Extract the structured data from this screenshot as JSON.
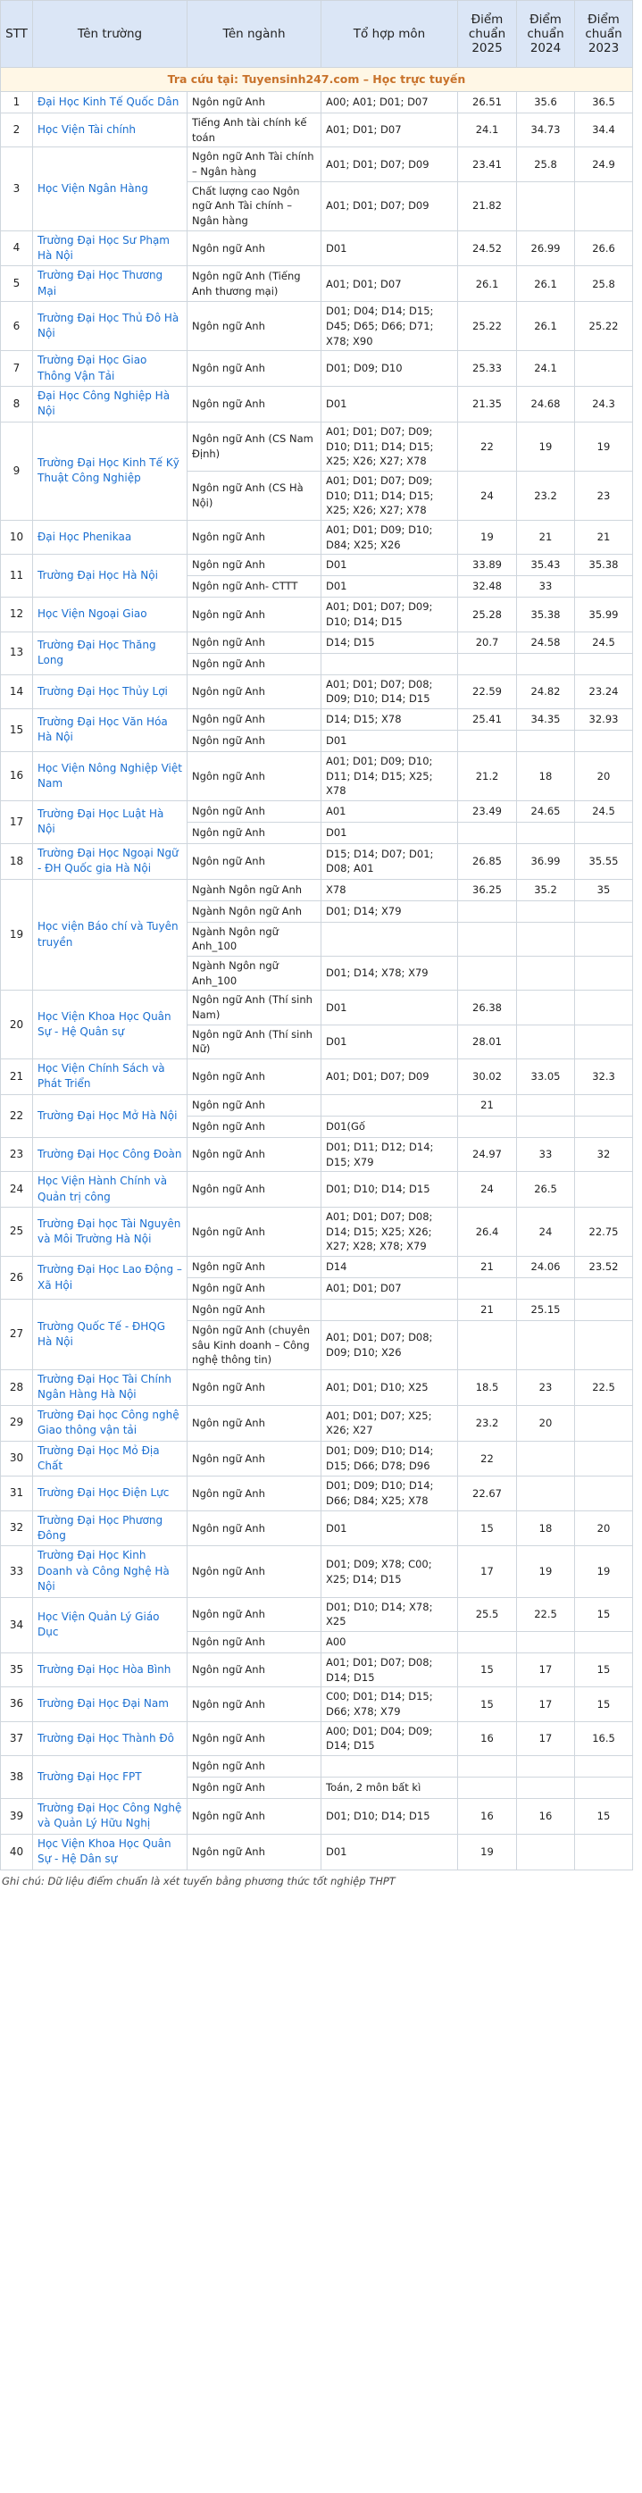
{
  "headers": {
    "stt": "STT",
    "school": "Tên trường",
    "major": "Tên ngành",
    "combo": "Tổ hợp môn",
    "y2025": "Điểm chuẩn 2025",
    "y2024": "Điểm chuẩn 2024",
    "y2023": "Điểm chuẩn 2023"
  },
  "banner": "Tra cứu tại: Tuyensinh247.com – Học trực tuyến",
  "rows": [
    {
      "stt": "1",
      "school": "Đại Học Kinh Tế Quốc Dân",
      "lines": [
        [
          "Ngôn ngữ Anh",
          "A00; A01; D01; D07",
          "26.51",
          "35.6",
          "36.5"
        ]
      ]
    },
    {
      "stt": "2",
      "school": "Học Viện Tài chính",
      "lines": [
        [
          "Tiếng Anh tài chính kế toán",
          "A01; D01; D07",
          "24.1",
          "34.73",
          "34.4"
        ]
      ]
    },
    {
      "stt": "3",
      "school": "Học Viện Ngân Hàng",
      "lines": [
        [
          "Ngôn ngữ Anh Tài chính – Ngân hàng",
          "A01; D01; D07; D09",
          "23.41",
          "25.8",
          "24.9"
        ],
        [
          "Chất lượng cao Ngôn ngữ Anh Tài chính – Ngân hàng",
          "A01; D01; D07; D09",
          "21.82",
          "",
          ""
        ]
      ]
    },
    {
      "stt": "4",
      "school": "Trường Đại Học Sư Phạm Hà Nội",
      "lines": [
        [
          "Ngôn ngữ Anh",
          "D01",
          "24.52",
          "26.99",
          "26.6"
        ]
      ]
    },
    {
      "stt": "5",
      "school": "Trường Đại Học Thương Mại",
      "lines": [
        [
          "Ngôn ngữ Anh (Tiếng Anh thương mại)",
          "A01; D01; D07",
          "26.1",
          "26.1",
          "25.8"
        ]
      ]
    },
    {
      "stt": "6",
      "school": "Trường Đại Học Thủ Đô Hà Nội",
      "lines": [
        [
          "Ngôn ngữ Anh",
          "D01; D04; D14; D15; D45; D65; D66; D71; X78; X90",
          "25.22",
          "26.1",
          "25.22"
        ]
      ]
    },
    {
      "stt": "7",
      "school": "Trường Đại Học Giao Thông Vận Tải",
      "lines": [
        [
          "Ngôn ngữ Anh",
          "D01; D09; D10",
          "25.33",
          "24.1",
          ""
        ]
      ]
    },
    {
      "stt": "8",
      "school": "Đại Học Công Nghiệp Hà Nội",
      "lines": [
        [
          "Ngôn ngữ Anh",
          "D01",
          "21.35",
          "24.68",
          "24.3"
        ]
      ]
    },
    {
      "stt": "9",
      "school": "Trường Đại Học Kinh Tế Kỹ Thuật Công Nghiệp",
      "lines": [
        [
          "Ngôn ngữ Anh (CS Nam Định)",
          "A01; D01; D07; D09; D10; D11; D14; D15; X25; X26; X27; X78",
          "22",
          "19",
          "19"
        ],
        [
          "Ngôn ngữ Anh (CS Hà Nội)",
          "A01; D01; D07; D09; D10; D11; D14; D15; X25; X26; X27; X78",
          "24",
          "23.2",
          "23"
        ]
      ]
    },
    {
      "stt": "10",
      "school": "Đại Học Phenikaa",
      "lines": [
        [
          "Ngôn ngữ Anh",
          "A01; D01; D09; D10; D84; X25; X26",
          "19",
          "21",
          "21"
        ]
      ]
    },
    {
      "stt": "11",
      "school": "Trường Đại Học Hà Nội",
      "lines": [
        [
          "Ngôn ngữ Anh",
          "D01",
          "33.89",
          "35.43",
          "35.38"
        ],
        [
          "Ngôn ngữ Anh- CTTT",
          "D01",
          "32.48",
          "33",
          ""
        ]
      ]
    },
    {
      "stt": "12",
      "school": "Học Viện Ngoại Giao",
      "lines": [
        [
          "Ngôn ngữ Anh",
          "A01; D01; D07; D09; D10; D14; D15",
          "25.28",
          "35.38",
          "35.99"
        ]
      ]
    },
    {
      "stt": "13",
      "school": "Trường Đại Học Thăng Long",
      "lines": [
        [
          "Ngôn ngữ Anh",
          "D14; D15",
          "20.7",
          "24.58",
          "24.5"
        ],
        [
          "Ngôn ngữ Anh",
          "",
          "",
          "",
          ""
        ]
      ]
    },
    {
      "stt": "14",
      "school": "Trường Đại Học Thủy Lợi",
      "lines": [
        [
          "Ngôn ngữ Anh",
          "A01; D01; D07; D08; D09; D10; D14; D15",
          "22.59",
          "24.82",
          "23.24"
        ]
      ]
    },
    {
      "stt": "15",
      "school": "Trường Đại Học Văn Hóa Hà Nội",
      "lines": [
        [
          "Ngôn ngữ Anh",
          "D14; D15; X78",
          "25.41",
          "34.35",
          "32.93"
        ],
        [
          "Ngôn ngữ Anh",
          "D01",
          "",
          "",
          ""
        ]
      ]
    },
    {
      "stt": "16",
      "school": "Học Viện Nông Nghiệp Việt Nam",
      "lines": [
        [
          "Ngôn ngữ Anh",
          "A01; D01; D09; D10; D11; D14; D15; X25; X78",
          "21.2",
          "18",
          "20"
        ]
      ]
    },
    {
      "stt": "17",
      "school": "Trường Đại Học Luật Hà Nội",
      "lines": [
        [
          "Ngôn ngữ Anh",
          "A01",
          "23.49",
          "24.65",
          "24.5"
        ],
        [
          "Ngôn ngữ Anh",
          "D01",
          "",
          "",
          ""
        ]
      ]
    },
    {
      "stt": "18",
      "school": "Trường Đại Học Ngoại Ngữ - ĐH Quốc gia Hà Nội",
      "lines": [
        [
          "Ngôn ngữ Anh",
          "D15; D14; D07; D01; D08; A01",
          "26.85",
          "36.99",
          "35.55"
        ]
      ]
    },
    {
      "stt": "19",
      "school": "Học viện Báo chí và Tuyên truyền",
      "lines": [
        [
          "Ngành Ngôn ngữ Anh",
          "X78",
          "36.25",
          "35.2",
          "35"
        ],
        [
          "Ngành Ngôn ngữ Anh",
          "D01; D14; X79",
          "",
          "",
          ""
        ],
        [
          "Ngành Ngôn ngữ Anh_100",
          "",
          "",
          "",
          ""
        ],
        [
          "Ngành Ngôn ngữ Anh_100",
          "D01; D14; X78; X79",
          "",
          "",
          ""
        ]
      ]
    },
    {
      "stt": "20",
      "school": "Học Viện Khoa Học Quân Sự - Hệ Quân sự",
      "lines": [
        [
          "Ngôn ngữ Anh (Thí sinh Nam)",
          "D01",
          "26.38",
          "",
          ""
        ],
        [
          "Ngôn ngữ Anh (Thí sinh Nữ)",
          "D01",
          "28.01",
          "",
          ""
        ]
      ]
    },
    {
      "stt": "21",
      "school": "Học Viện Chính Sách và Phát Triển",
      "lines": [
        [
          "Ngôn ngữ Anh",
          "A01; D01; D07; D09",
          "30.02",
          "33.05",
          "32.3"
        ]
      ]
    },
    {
      "stt": "22",
      "school": "Trường Đại Học Mở Hà Nội",
      "lines": [
        [
          "Ngôn ngữ Anh",
          "",
          "21",
          "",
          ""
        ],
        [
          "Ngôn ngữ Anh",
          "D01(Gố",
          "",
          "",
          ""
        ]
      ]
    },
    {
      "stt": "23",
      "school": "Trường Đại Học Công Đoàn",
      "lines": [
        [
          "Ngôn ngữ Anh",
          "D01; D11; D12; D14; D15; X79",
          "24.97",
          "33",
          "32"
        ]
      ]
    },
    {
      "stt": "24",
      "school": "Học Viện Hành Chính và Quản trị công",
      "lines": [
        [
          "Ngôn ngữ Anh",
          "D01; D10; D14; D15",
          "24",
          "26.5",
          ""
        ]
      ]
    },
    {
      "stt": "25",
      "school": "Trường Đại học Tài Nguyên và Môi Trường Hà Nội",
      "lines": [
        [
          "Ngôn ngữ Anh",
          "A01; D01; D07; D08; D14; D15; X25; X26; X27; X28; X78; X79",
          "26.4",
          "24",
          "22.75"
        ]
      ]
    },
    {
      "stt": "26",
      "school": "Trường Đại Học Lao Động – Xã Hội",
      "lines": [
        [
          "Ngôn ngữ Anh",
          "D14",
          "21",
          "24.06",
          "23.52"
        ],
        [
          "Ngôn ngữ Anh",
          "A01; D01; D07",
          "",
          "",
          ""
        ]
      ]
    },
    {
      "stt": "27",
      "school": "Trường Quốc Tế - ĐHQG Hà Nội",
      "lines": [
        [
          "Ngôn ngữ Anh",
          "",
          "21",
          "25.15",
          ""
        ],
        [
          "Ngôn ngữ Anh (chuyên sâu Kinh doanh – Công nghệ thông tin)",
          "A01; D01; D07; D08; D09; D10; X26",
          "",
          "",
          ""
        ]
      ]
    },
    {
      "stt": "28",
      "school": "Trường Đại Học Tài Chính Ngân Hàng Hà Nội",
      "lines": [
        [
          "Ngôn ngữ Anh",
          "A01; D01; D10; X25",
          "18.5",
          "23",
          "22.5"
        ]
      ]
    },
    {
      "stt": "29",
      "school": "Trường Đại học Công nghệ Giao thông vận tải",
      "lines": [
        [
          "Ngôn ngữ Anh",
          "A01; D01; D07; X25; X26; X27",
          "23.2",
          "20",
          ""
        ]
      ]
    },
    {
      "stt": "30",
      "school": "Trường Đại Học Mỏ Địa Chất",
      "lines": [
        [
          "Ngôn ngữ Anh",
          "D01; D09; D10; D14; D15; D66; D78; D96",
          "22",
          "",
          ""
        ]
      ]
    },
    {
      "stt": "31",
      "school": "Trường Đại Học Điện Lực",
      "lines": [
        [
          "Ngôn ngữ Anh",
          "D01; D09; D10; D14; D66; D84; X25; X78",
          "22.67",
          "",
          ""
        ]
      ]
    },
    {
      "stt": "32",
      "school": "Trường Đại Học Phương Đông",
      "lines": [
        [
          "Ngôn ngữ Anh",
          "D01",
          "15",
          "18",
          "20"
        ]
      ]
    },
    {
      "stt": "33",
      "school": "Trường Đại Học Kinh Doanh và Công Nghệ Hà Nội",
      "lines": [
        [
          "Ngôn ngữ Anh",
          "D01; D09; X78; C00; X25; D14; D15",
          "17",
          "19",
          "19"
        ]
      ]
    },
    {
      "stt": "34",
      "school": "Học Viện Quản Lý Giáo Dục",
      "lines": [
        [
          "Ngôn ngữ Anh",
          "D01; D10; D14; X78; X25",
          "25.5",
          "22.5",
          "15"
        ],
        [
          "Ngôn ngữ Anh",
          "A00",
          "",
          "",
          ""
        ]
      ]
    },
    {
      "stt": "35",
      "school": "Trường Đại Học Hòa Bình",
      "lines": [
        [
          "Ngôn ngữ Anh",
          "A01; D01; D07; D08; D14; D15",
          "15",
          "17",
          "15"
        ]
      ]
    },
    {
      "stt": "36",
      "school": "Trường Đại Học Đại Nam",
      "lines": [
        [
          "Ngôn ngữ Anh",
          "C00; D01; D14; D15; D66; X78; X79",
          "15",
          "17",
          "15"
        ]
      ]
    },
    {
      "stt": "37",
      "school": "Trường Đại Học Thành Đô",
      "lines": [
        [
          "Ngôn ngữ Anh",
          "A00; D01; D04; D09; D14; D15",
          "16",
          "17",
          "16.5"
        ]
      ]
    },
    {
      "stt": "38",
      "school": "Trường Đại Học FPT",
      "lines": [
        [
          "Ngôn ngữ Anh",
          "",
          "",
          "",
          ""
        ],
        [
          "Ngôn ngữ Anh",
          "Toán, 2 môn bất kì",
          "",
          "",
          ""
        ]
      ]
    },
    {
      "stt": "39",
      "school": "Trường Đại Học Công Nghệ và Quản Lý Hữu Nghị",
      "lines": [
        [
          "Ngôn ngữ Anh",
          "D01; D10; D14; D15",
          "16",
          "16",
          "15"
        ]
      ]
    },
    {
      "stt": "40",
      "school": "Học Viện Khoa Học Quân Sự - Hệ Dân sự",
      "lines": [
        [
          "Ngôn ngữ Anh",
          "D01",
          "19",
          "",
          ""
        ]
      ]
    }
  ],
  "note": "Ghi chú: Dữ liệu điểm chuẩn là xét tuyển bằng phương thức tốt nghiệp THPT"
}
